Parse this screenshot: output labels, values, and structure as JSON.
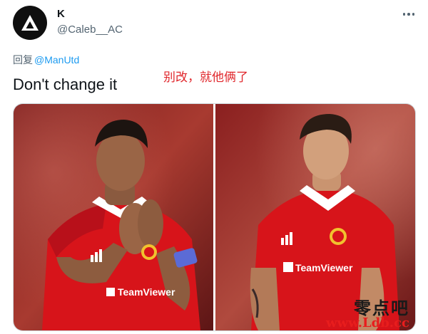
{
  "author": {
    "name": "K",
    "handle": "@Caleb__AC",
    "avatar_icon": "triangle-logo-icon"
  },
  "menu": {
    "more_icon": "more-dots-icon"
  },
  "reply": {
    "prefix": "回复",
    "mention": "@ManUtd"
  },
  "tweet": {
    "text": "Don't change it",
    "overlay_caption": "别改，就他俩了"
  },
  "media": {
    "photos": [
      {
        "subject": "player-left",
        "sponsor_text": "TeamViewer",
        "kit_brand": "adidas"
      },
      {
        "subject": "player-right",
        "sponsor_text": "TeamViewer",
        "kit_brand": "adidas"
      }
    ]
  },
  "watermark": {
    "top": "零点吧",
    "bottom": "www.Ldb.cc"
  },
  "colors": {
    "link": "#1d9bf0",
    "caption_red": "#e0262b",
    "kit_red": "#d7141a"
  }
}
